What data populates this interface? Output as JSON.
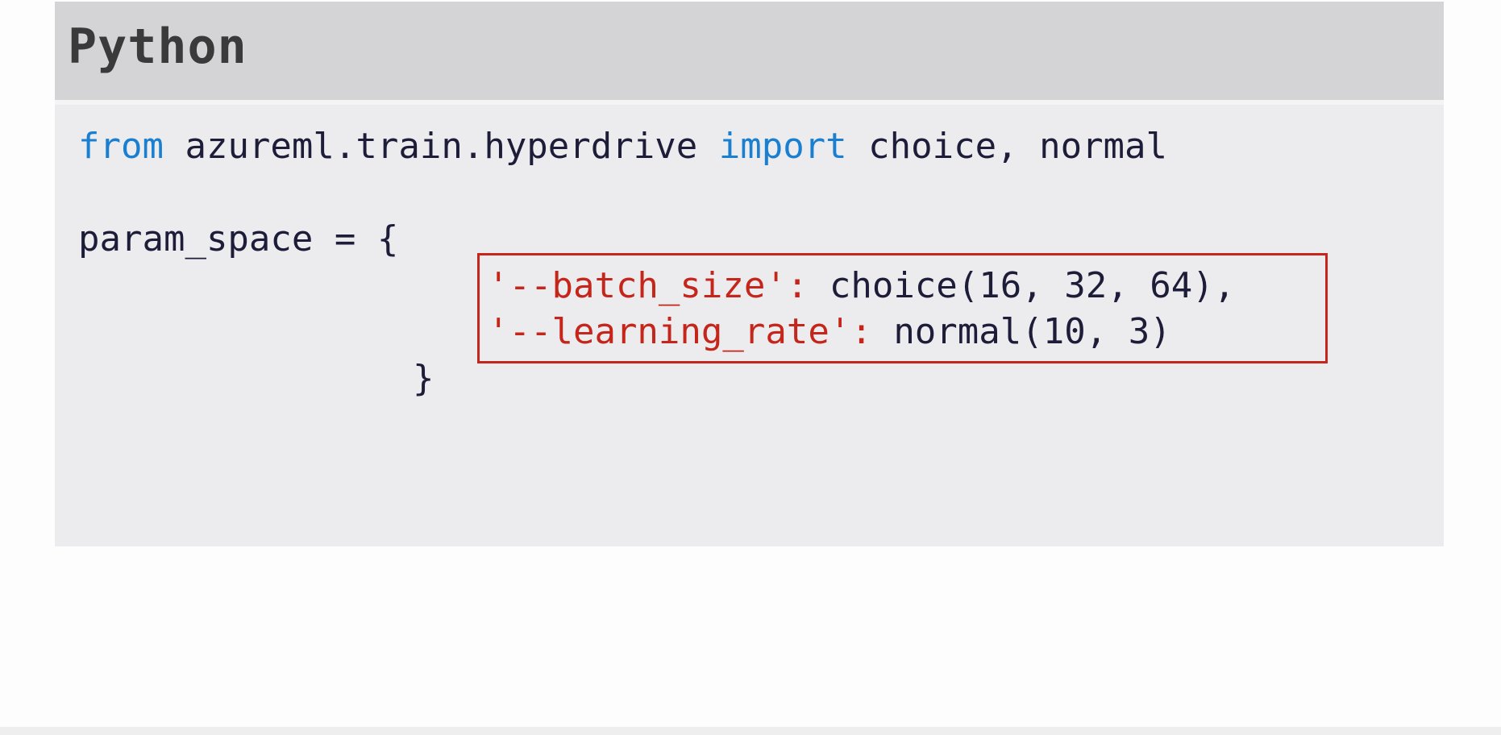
{
  "header": {
    "title": "Python"
  },
  "code": {
    "line1": {
      "kw_from": "from",
      "module": " azureml.train.hyperdrive ",
      "kw_import": "import",
      "names": " choice, normal"
    },
    "line2": {
      "text": "param_space = {"
    },
    "line3": {
      "key": "'--batch_size':",
      "value": " choice(16, 32, 64),"
    },
    "line4": {
      "key": "'--learning_rate':",
      "value": " normal(10, 3)"
    },
    "line5": {
      "text": "}"
    }
  },
  "colors": {
    "keyword": "#1a7fd1",
    "string": "#c4261b",
    "text": "#1d1d3a",
    "highlight_border": "#c4261b",
    "header_bg": "#d4d3d6",
    "code_bg": "#ececee"
  }
}
